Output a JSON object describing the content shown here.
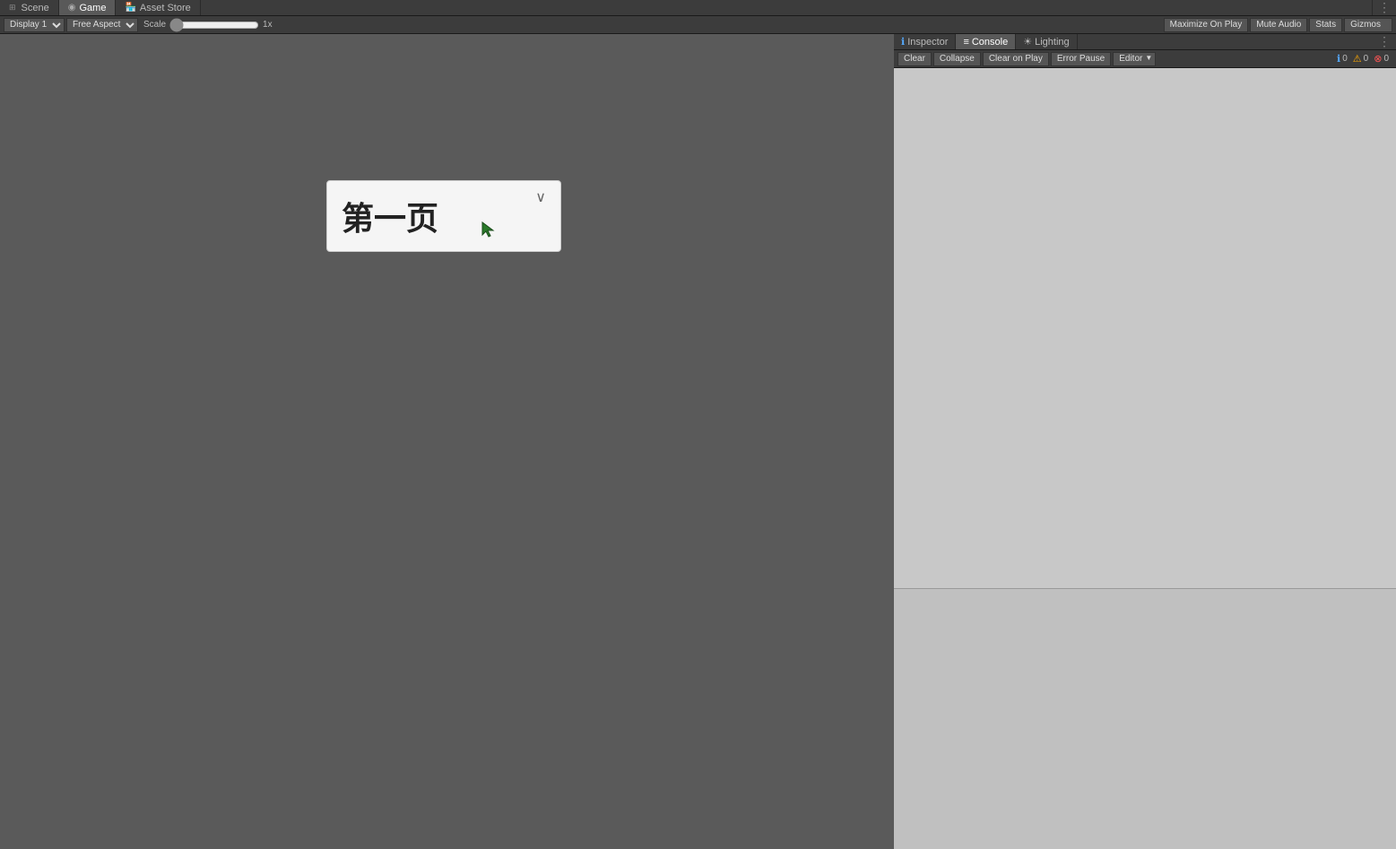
{
  "tabs_left": [
    {
      "id": "scene",
      "label": "Scene",
      "icon": "⊞",
      "active": false
    },
    {
      "id": "game",
      "label": "Game",
      "icon": "▶",
      "active": true
    },
    {
      "id": "asset-store",
      "label": "Asset Store",
      "icon": "🏪",
      "active": false
    }
  ],
  "toolbar": {
    "display_label": "Display 1",
    "aspect_label": "Free Aspect",
    "scale_label": "Scale",
    "scale_value": "1x",
    "maximize_label": "Maximize On Play",
    "mute_label": "Mute Audio",
    "stats_label": "Stats",
    "gizmos_label": "Gizmos"
  },
  "game_card": {
    "text": "第一页",
    "chevron": "∨"
  },
  "tabs_right": [
    {
      "id": "inspector",
      "label": "Inspector",
      "icon": "ℹ",
      "active": false
    },
    {
      "id": "console",
      "label": "Console",
      "icon": "≡",
      "active": true
    },
    {
      "id": "lighting",
      "label": "Lighting",
      "icon": "☀",
      "active": false
    }
  ],
  "console_toolbar": {
    "clear_label": "Clear",
    "collapse_label": "Collapse",
    "clear_on_play_label": "Clear on Play",
    "error_pause_label": "Error Pause",
    "editor_label": "Editor"
  },
  "console_badges": {
    "info_count": "0",
    "warning_count": "0",
    "error_count": "0"
  }
}
